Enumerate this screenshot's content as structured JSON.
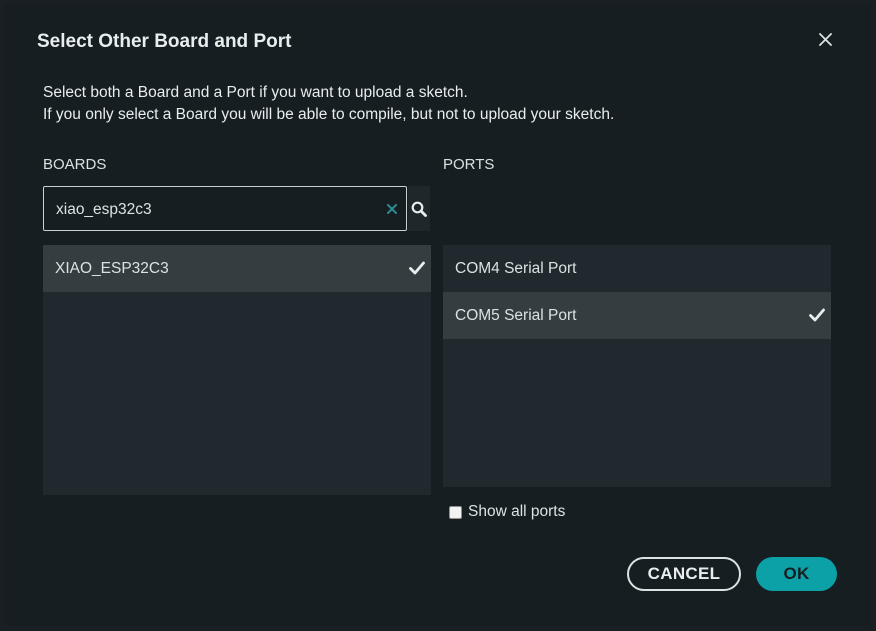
{
  "dialog": {
    "title": "Select Other Board and Port",
    "intro_line1": "Select both a Board and a Port if you want to upload a sketch.",
    "intro_line2": "If you only select a Board you will be able to compile, but not to upload your sketch."
  },
  "boards": {
    "label": "BOARDS",
    "search_value": "xiao_esp32c3",
    "items": [
      {
        "label": "XIAO_ESP32C3",
        "selected": true
      }
    ]
  },
  "ports": {
    "label": "PORTS",
    "items": [
      {
        "label": "COM4 Serial Port",
        "selected": false
      },
      {
        "label": "COM5 Serial Port",
        "selected": true
      }
    ],
    "show_all_label": "Show all ports",
    "show_all_checked": false
  },
  "buttons": {
    "cancel": "CANCEL",
    "ok": "OK"
  },
  "colors": {
    "background": "#171e21",
    "list_background": "#20292d",
    "selected_row": "#343d40",
    "accent": "#0ca1a6"
  },
  "icons": {
    "close": "close-icon",
    "clear": "clear-x-icon",
    "search": "search-icon",
    "check": "checkmark-icon"
  }
}
